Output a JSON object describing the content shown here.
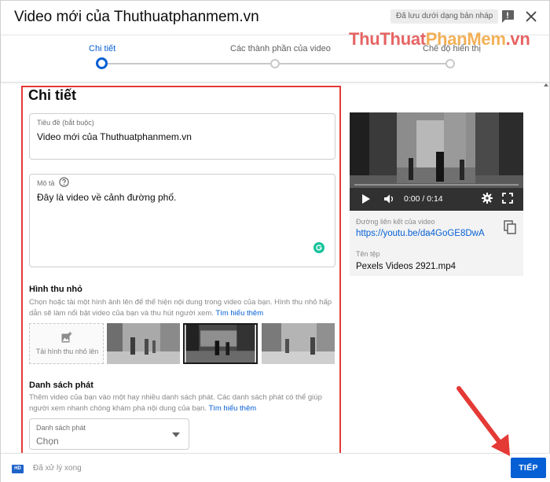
{
  "header": {
    "title": "Video mới của Thuthuatphanmem.vn",
    "draft_status": "Đã lưu dưới dạng bản nháp"
  },
  "watermark": {
    "part1": "ThuThuat",
    "part2": "PhanMem",
    "part3": ".vn"
  },
  "stepper": {
    "steps": [
      {
        "label": "Chi tiết",
        "active": true
      },
      {
        "label": "Các thành phần của video",
        "active": false
      },
      {
        "label": "Chế độ hiển thị",
        "active": false
      }
    ]
  },
  "details": {
    "heading": "Chi tiết",
    "title_field": {
      "label": "Tiêu đề (bắt buộc)",
      "value": "Video mới của Thuthuatphanmem.vn"
    },
    "description_field": {
      "label": "Mô tả",
      "value": "Đây là video về cảnh đường phố."
    },
    "thumbnail": {
      "heading": "Hình thu nhỏ",
      "description": "Chọn hoặc tải một hình ảnh lên để thể hiện nội dung trong video của bạn. Hình thu nhỏ hấp dẫn sẽ làm nổi bật video của bạn và thu hút người xem.",
      "learn_more": "Tìm hiểu thêm",
      "upload_label": "Tải hình thu nhỏ lên",
      "selected_index": 1
    },
    "playlist": {
      "heading": "Danh sách phát",
      "description": "Thêm video của bạn vào một hay nhiều danh sách phát. Các danh sách phát có thể giúp người xem nhanh chóng khám phá nội dung của bạn.",
      "learn_more": "Tìm hiểu thêm",
      "select_label": "Danh sách phát",
      "select_value": "Chọn"
    }
  },
  "preview": {
    "time": "0:00 / 0:14",
    "progress": 0,
    "link_label": "Đường liên kết của video",
    "link_value": "https://youtu.be/da4GoGE8DwA",
    "filename_label": "Tên tệp",
    "filename_value": "Pexels Videos 2921.mp4"
  },
  "footer": {
    "hd_badge": "HD",
    "status": "Đã xử lý xong",
    "next_label": "TIẾP"
  },
  "colors": {
    "accent": "#065fd4",
    "highlight": "#e53935"
  }
}
